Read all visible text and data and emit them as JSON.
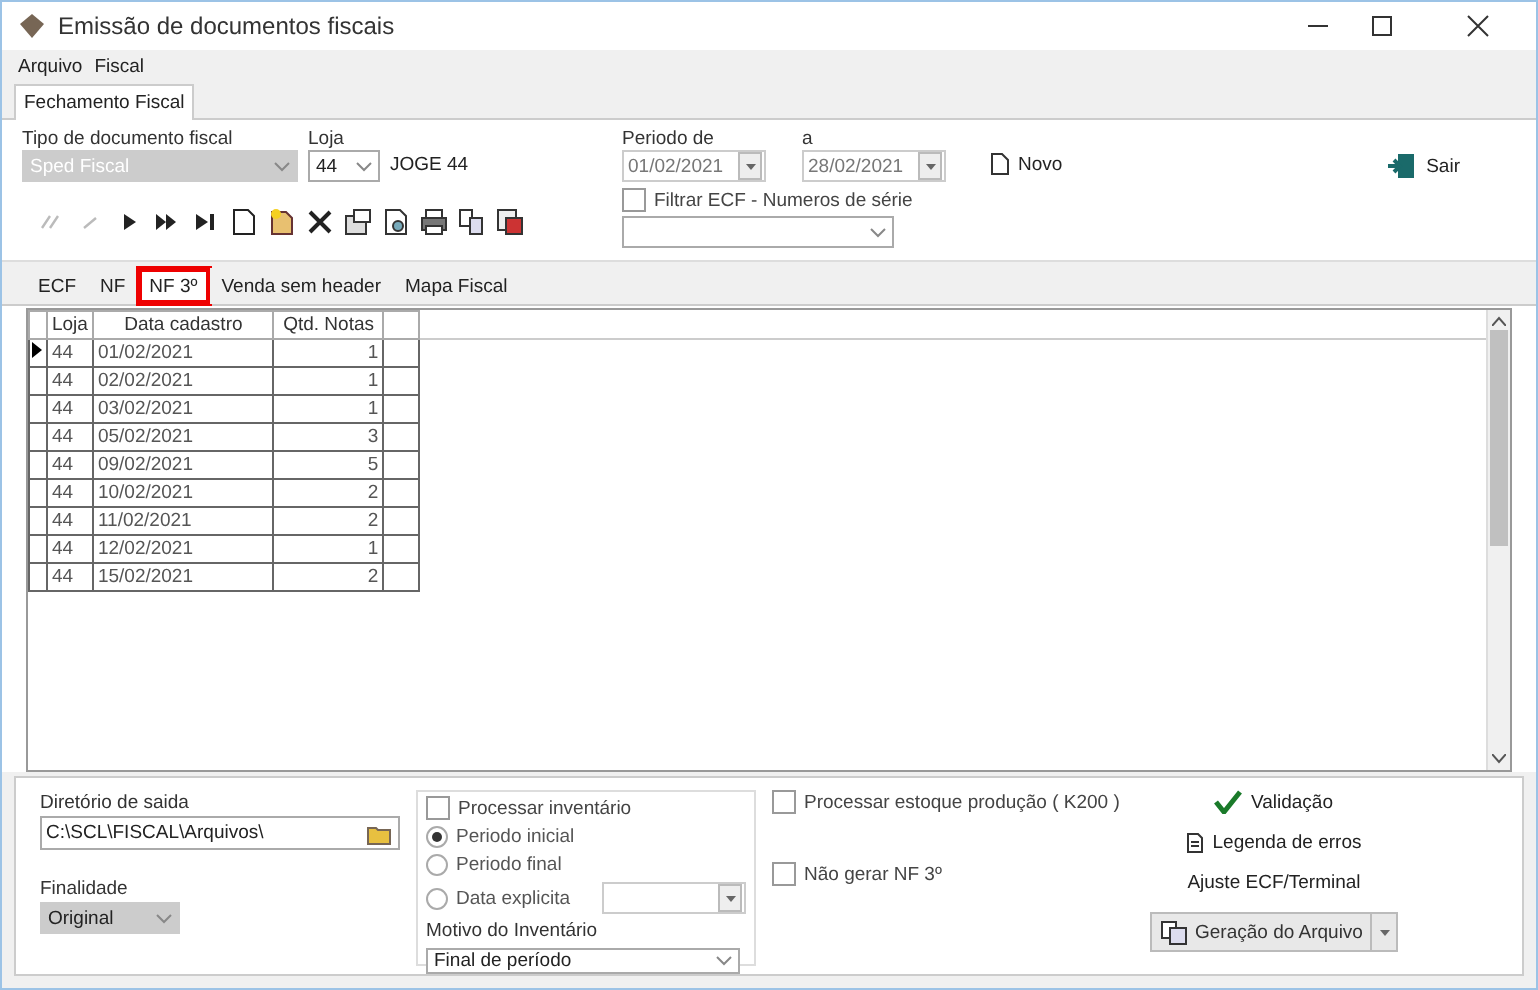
{
  "window": {
    "title": "Emissão de documentos fiscais"
  },
  "menu": [
    "Arquivo",
    "Fiscal"
  ],
  "main_tabs": [
    {
      "label": "Fechamento Fiscal",
      "selected": true
    }
  ],
  "form": {
    "tipo_documento": {
      "label": "Tipo de documento fiscal",
      "value": "Sped Fiscal",
      "disabled": true
    },
    "loja": {
      "label": "Loja",
      "value": "44",
      "store_name": "JOGE 44"
    },
    "periodo_de": {
      "label": "Periodo  de",
      "value": "01/02/2021",
      "disabled": true
    },
    "periodo_a": {
      "label": "a",
      "value": "28/02/2021",
      "disabled": true
    },
    "novo_button": "Novo",
    "sair_button": "Sair",
    "filtrar_ecf": {
      "label": "Filtrar ECF - Numeros de  série",
      "checked": false
    }
  },
  "data_tabs": [
    {
      "label": "ECF",
      "selected": false,
      "highlighted": false
    },
    {
      "label": "NF",
      "selected": false,
      "highlighted": false
    },
    {
      "label": "NF 3º",
      "selected": true,
      "highlighted": true
    },
    {
      "label": "Venda sem header",
      "selected": false,
      "highlighted": false
    },
    {
      "label": "Mapa Fiscal",
      "selected": false,
      "highlighted": false
    }
  ],
  "table": {
    "columns": [
      "Loja",
      "Data cadastro",
      "Qtd. Notas"
    ],
    "rows": [
      {
        "cells": [
          "44",
          "01/02/2021",
          "1"
        ],
        "selected": true
      },
      {
        "cells": [
          "44",
          "02/02/2021",
          "1"
        ],
        "selected": false
      },
      {
        "cells": [
          "44",
          "03/02/2021",
          "1"
        ],
        "selected": false
      },
      {
        "cells": [
          "44",
          "05/02/2021",
          "3"
        ],
        "selected": false
      },
      {
        "cells": [
          "44",
          "09/02/2021",
          "5"
        ],
        "selected": false
      },
      {
        "cells": [
          "44",
          "10/02/2021",
          "2"
        ],
        "selected": false
      },
      {
        "cells": [
          "44",
          "11/02/2021",
          "2"
        ],
        "selected": false
      },
      {
        "cells": [
          "44",
          "12/02/2021",
          "1"
        ],
        "selected": false
      },
      {
        "cells": [
          "44",
          "15/02/2021",
          "2"
        ],
        "selected": false
      }
    ]
  },
  "bottom": {
    "diretorio": {
      "label": "Diretório de saida",
      "value": "C:\\SCL\\FISCAL\\Arquivos\\"
    },
    "finalidade": {
      "label": "Finalidade",
      "value": "Original"
    },
    "processar_inventario": {
      "label": "Processar inventário",
      "checked": false
    },
    "inventory_period": [
      {
        "label": "Periodo inicial",
        "selected": true
      },
      {
        "label": "Periodo final",
        "selected": false
      },
      {
        "label": "Data explicita",
        "selected": false
      }
    ],
    "motivo": {
      "label": "Motivo do Inventário",
      "value": "Final de período"
    },
    "processar_estoque": {
      "label": "Processar estoque produção ( K200 )",
      "checked": false
    },
    "nao_gerar": {
      "label": "Não gerar NF 3º",
      "checked": false
    },
    "validacao_button": "Validação",
    "legenda_button": "Legenda de erros",
    "ajuste_button": "Ajuste ECF/Terminal",
    "geracao_button": "Geração do Arquivo"
  }
}
